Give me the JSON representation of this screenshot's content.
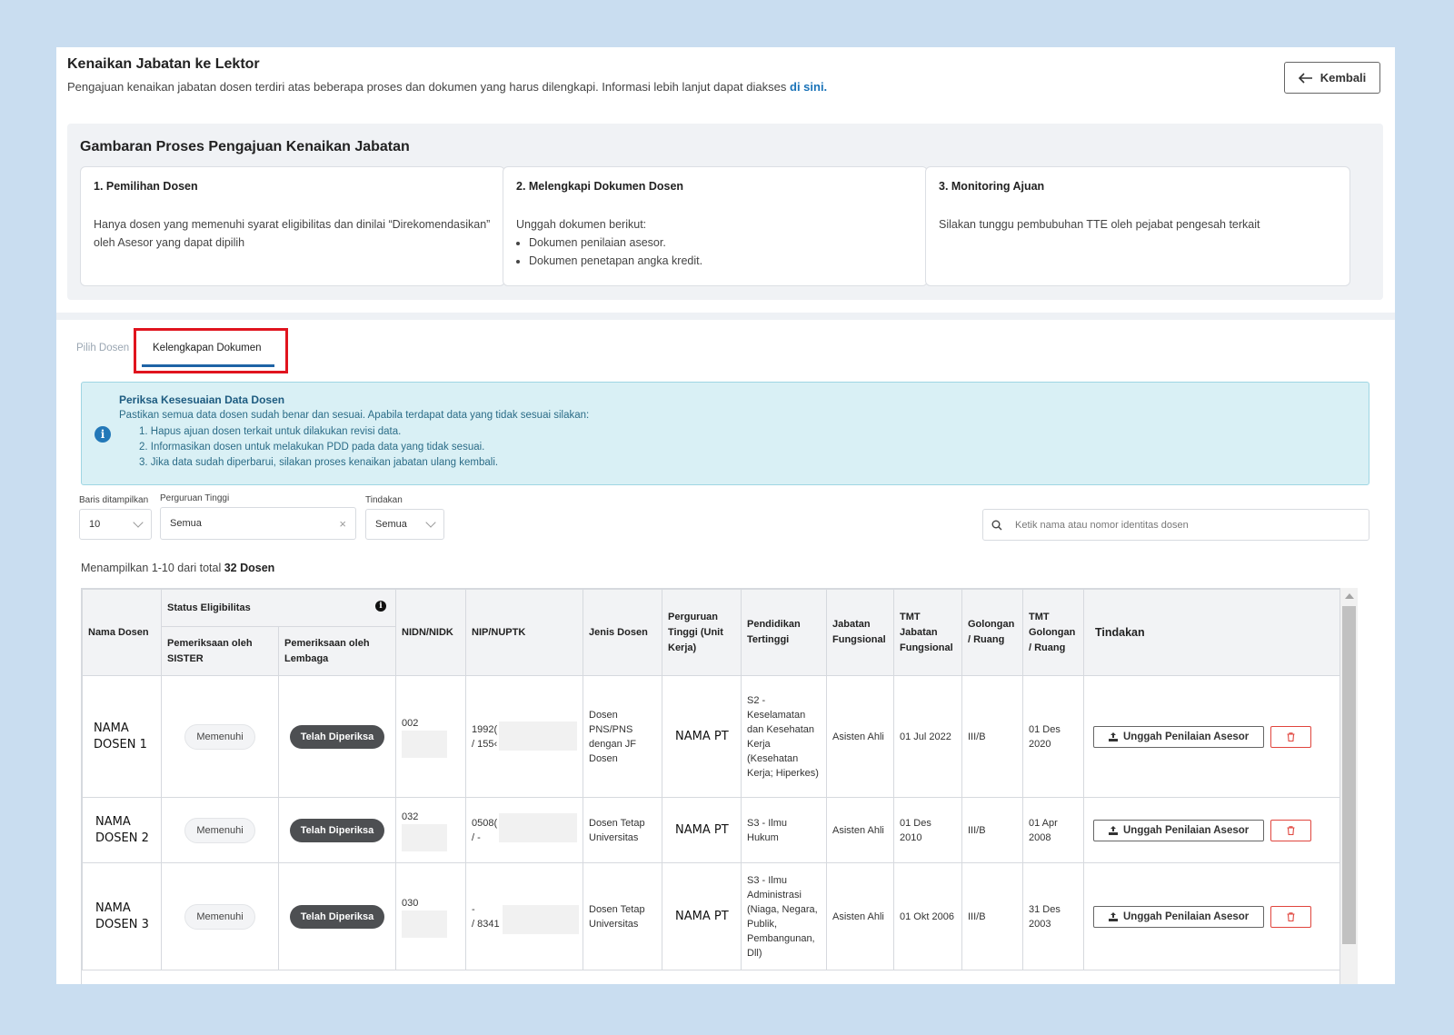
{
  "header": {
    "title": "Kenaikan Jabatan ke Lektor",
    "description": "Pengajuan kenaikan jabatan dosen terdiri atas beberapa proses dan dokumen yang harus dilengkapi. Informasi lebih lanjut dapat diakses",
    "link_label": "di sini.",
    "back_label": "Kembali"
  },
  "process": {
    "title": "Gambaran Proses Pengajuan Kenaikan Jabatan",
    "steps": [
      {
        "title": "1. Pemilihan Dosen",
        "text": "Hanya dosen yang memenuhi syarat eligibilitas dan dinilai “Direkomendasikan” oleh Asesor yang dapat dipilih"
      },
      {
        "title": "2. Melengkapi Dokumen Dosen",
        "text": "Unggah dokumen berikut:",
        "bullets": [
          "Dokumen penilaian asesor.",
          "Dokumen penetapan angka kredit."
        ]
      },
      {
        "title": "3. Monitoring Ajuan",
        "text": "Silakan tunggu pembubuhan TTE oleh pejabat pengesah terkait"
      }
    ]
  },
  "tabs": [
    {
      "label": "Pilih Dosen",
      "active": false
    },
    {
      "label": "Kelengkapan Dokumen",
      "active": true
    }
  ],
  "alert": {
    "title": "Periksa Kesesuaian Data Dosen",
    "description": "Pastikan semua data dosen sudah benar dan sesuai. Apabila terdapat data yang tidak sesuai silakan:",
    "items": [
      "1. Hapus ajuan dosen terkait untuk dilakukan revisi data.",
      "2. Informasikan dosen untuk melakukan PDD pada data yang tidak sesuai.",
      "3. Jika data sudah diperbarui, silakan proses kenaikan jabatan ulang kembali."
    ]
  },
  "filters": {
    "rows_label": "Baris ditampilkan",
    "rows_value": "10",
    "pt_label": "Perguruan Tinggi",
    "pt_value": "Semua",
    "tindakan_label": "Tindakan",
    "tindakan_value": "Semua",
    "search_placeholder": "Ketik nama atau nomor identitas dosen"
  },
  "summary": {
    "prefix": "Menampilkan 1-10 dari total",
    "total": "32 Dosen"
  },
  "table": {
    "headers": {
      "nama": "Nama Dosen",
      "status": "Status Eligibilitas",
      "sister": "Pemeriksaan oleh SISTER",
      "lembaga": "Pemeriksaan oleh Lembaga",
      "nidn": "NIDN/NIDK",
      "nip": "NIP/NUPTK",
      "jenis": "Jenis Dosen",
      "pt": "Perguruan Tinggi (Unit Kerja)",
      "pendidikan": "Pendidikan Tertinggi",
      "jabatan": "Jabatan Fungsional",
      "tmt_jabatan": "TMT Jabatan Fungsional",
      "golongan": "Golongan / Ruang",
      "tmt_golongan": "TMT Golongan / Ruang",
      "tindakan": "Tindakan"
    },
    "rows": [
      {
        "nama": "NAMA DOSEN 1",
        "sister": "Memenuhi",
        "lembaga": "Telah Diperiksa",
        "nidn": "002",
        "nip_a": "1992(",
        "nip_b": "/ 155‹",
        "jenis": "Dosen PNS/PNS dengan JF Dosen",
        "pt": "NAMA PT",
        "pendidikan": "S2 - Keselamatan dan Kesehatan Kerja (Kesehatan Kerja; Hiperkes)",
        "jabatan": "Asisten Ahli",
        "tmt_jabatan": "01 Jul 2022",
        "golongan": "III/B",
        "tmt_golongan": "01 Des 2020",
        "upload": "Unggah Penilaian Asesor"
      },
      {
        "nama": "NAMA DOSEN 2",
        "sister": "Memenuhi",
        "lembaga": "Telah Diperiksa",
        "nidn": "032",
        "nip_a": "0508(",
        "nip_b": "/ -",
        "jenis": "Dosen Tetap Universitas",
        "pt": "NAMA PT",
        "pendidikan": "S3 - Ilmu Hukum",
        "jabatan": "Asisten Ahli",
        "tmt_jabatan": "01 Des 2010",
        "golongan": "III/B",
        "tmt_golongan": "01 Apr 2008",
        "upload": "Unggah Penilaian Asesor"
      },
      {
        "nama": "NAMA DOSEN 3",
        "sister": "Memenuhi",
        "lembaga": "Telah Diperiksa",
        "nidn": "030",
        "nip_a": "-",
        "nip_b": "/ 8341",
        "jenis": "Dosen Tetap Universitas",
        "pt": "NAMA PT",
        "pendidikan": "S3 - Ilmu Administrasi (Niaga, Negara, Publik, Pembangunan, Dll)",
        "jabatan": "Asisten Ahli",
        "tmt_jabatan": "01 Okt 2006",
        "golongan": "III/B",
        "tmt_golongan": "31 Des 2003",
        "upload": "Unggah Penilaian Asesor"
      }
    ]
  },
  "colors": {
    "page_bg": "#c9ddf0",
    "link": "#1a73b8",
    "tab_active_underline": "#1e63a5",
    "highlight": "#e0141e",
    "alert_bg": "#d9f0f5",
    "pill_dark": "#4d4f52",
    "delete_red": "#e0453d"
  },
  "icons": {
    "back": "arrow-left-icon",
    "info": "info-circle-icon",
    "search": "search-icon",
    "upload": "upload-icon",
    "delete": "trash-icon"
  }
}
